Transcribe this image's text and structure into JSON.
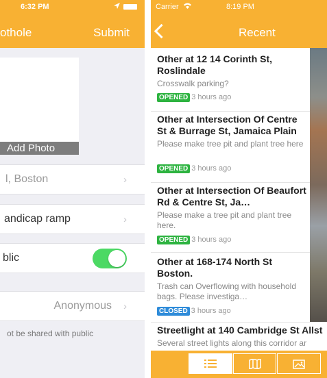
{
  "left_screen": {
    "status_time": "6:32 PM",
    "nav_title": "othole",
    "submit_label": "Submit",
    "add_photo_label": "Add Photo",
    "location_value": "l, Boston",
    "type_value": "andicap ramp",
    "public_label": "blic",
    "public_toggle_on": true,
    "name_value": "Anonymous",
    "privacy_note": "ot be shared with public"
  },
  "right_screen": {
    "carrier": "Carrier",
    "status_time": "8:19 PM",
    "nav_title": "Recent",
    "items": [
      {
        "title": "Other at 12 14 Corinth St, Roslindale",
        "desc": "Crosswalk parking?",
        "status": "OPENED",
        "time": "3 hours ago"
      },
      {
        "title": "Other at Intersection Of Centre St & Burrage St, Jamaica Plain",
        "desc": "Please make tree pit and plant tree here",
        "status": "OPENED",
        "time": "3 hours ago"
      },
      {
        "title": "Other at Intersection Of Beaufort Rd & Centre St, Ja…",
        "desc": "Please make a tree pit and plant tree here.",
        "status": "OPENED",
        "time": "3 hours ago"
      },
      {
        "title": "Other at 168-174 North St Boston.",
        "desc": "Trash can Overflowing with household bags. Please investiga…",
        "status": "CLOSED",
        "time": "3 hours ago"
      },
      {
        "title": "Streetlight at 140 Cambridge St Allst",
        "desc": "Several street lights along this corridor ar"
      }
    ],
    "tabs": [
      "list-icon",
      "map-icon",
      "photo-icon"
    ],
    "colors": {
      "accent": "#f8b133",
      "opened": "#2db340",
      "closed": "#2e8bd9",
      "toggle_on": "#4cd964"
    }
  }
}
